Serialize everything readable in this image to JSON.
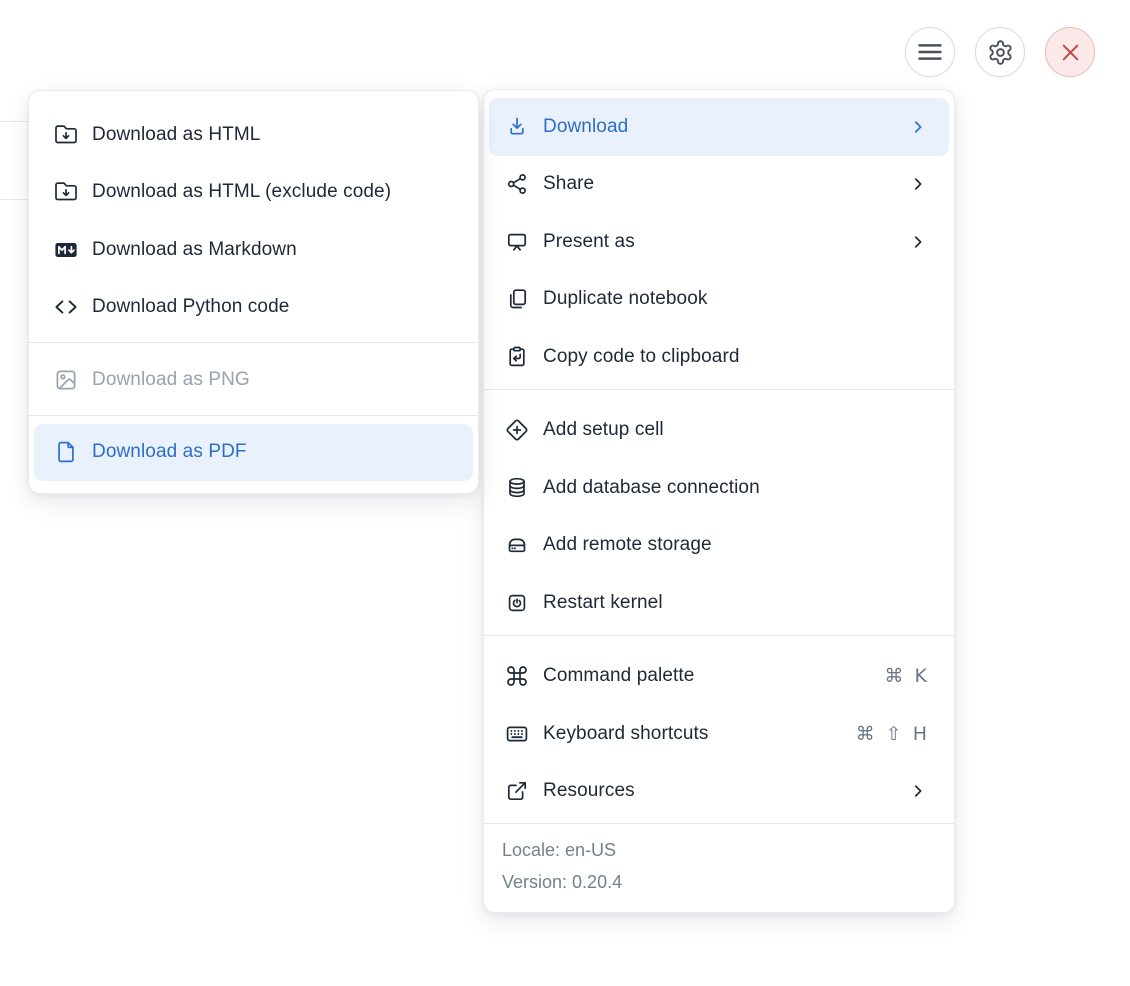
{
  "toolbar": {
    "buttons": [
      {
        "id": "notebook-menu",
        "icon": "hamburger-icon"
      },
      {
        "id": "settings",
        "icon": "gear-icon"
      },
      {
        "id": "close",
        "icon": "close-icon"
      }
    ]
  },
  "main_menu": {
    "sections": [
      {
        "items": [
          {
            "label": "Download",
            "icon": "download-icon",
            "chevron": true,
            "state": "active"
          },
          {
            "label": "Share",
            "icon": "share-icon",
            "chevron": true
          },
          {
            "label": "Present as",
            "icon": "presentation-icon",
            "chevron": true
          },
          {
            "label": "Duplicate notebook",
            "icon": "duplicate-icon"
          },
          {
            "label": "Copy code to clipboard",
            "icon": "clipboard-arrow-icon"
          }
        ]
      },
      {
        "items": [
          {
            "label": "Add setup cell",
            "icon": "diamond-plus-icon"
          },
          {
            "label": "Add database connection",
            "icon": "database-icon"
          },
          {
            "label": "Add remote storage",
            "icon": "hard-drive-icon"
          },
          {
            "label": "Restart kernel",
            "icon": "power-square-icon"
          }
        ]
      },
      {
        "items": [
          {
            "label": "Command palette",
            "icon": "command-icon",
            "shortcut": [
              "⌘",
              "K"
            ]
          },
          {
            "label": "Keyboard shortcuts",
            "icon": "keyboard-icon",
            "shortcut": [
              "⌘",
              "⇧",
              "H"
            ]
          },
          {
            "label": "Resources",
            "icon": "external-link-icon",
            "chevron": true
          }
        ]
      }
    ],
    "footer": {
      "locale": "Locale: en-US",
      "version": "Version: 0.20.4"
    }
  },
  "download_submenu": {
    "sections": [
      {
        "items": [
          {
            "label": "Download as HTML",
            "icon": "folder-down-icon"
          },
          {
            "label": "Download as HTML (exclude code)",
            "icon": "folder-down-icon"
          },
          {
            "label": "Download as Markdown",
            "icon": "markdown-icon"
          },
          {
            "label": "Download Python code",
            "icon": "code-icon"
          }
        ]
      },
      {
        "items": [
          {
            "label": "Download as PNG",
            "icon": "image-icon",
            "state": "disabled"
          }
        ]
      },
      {
        "items": [
          {
            "label": "Download as PDF",
            "icon": "file-icon",
            "state": "active"
          }
        ]
      }
    ]
  },
  "colors": {
    "accent_blue": "#2e6ec9",
    "active_row_bg": "#e9f1fc",
    "text": "#1e2838",
    "muted_gray": "#6d7585",
    "disabled_gray": "#9aa2ae",
    "danger_red": "#c84545",
    "danger_bg": "#fbe9e9"
  }
}
